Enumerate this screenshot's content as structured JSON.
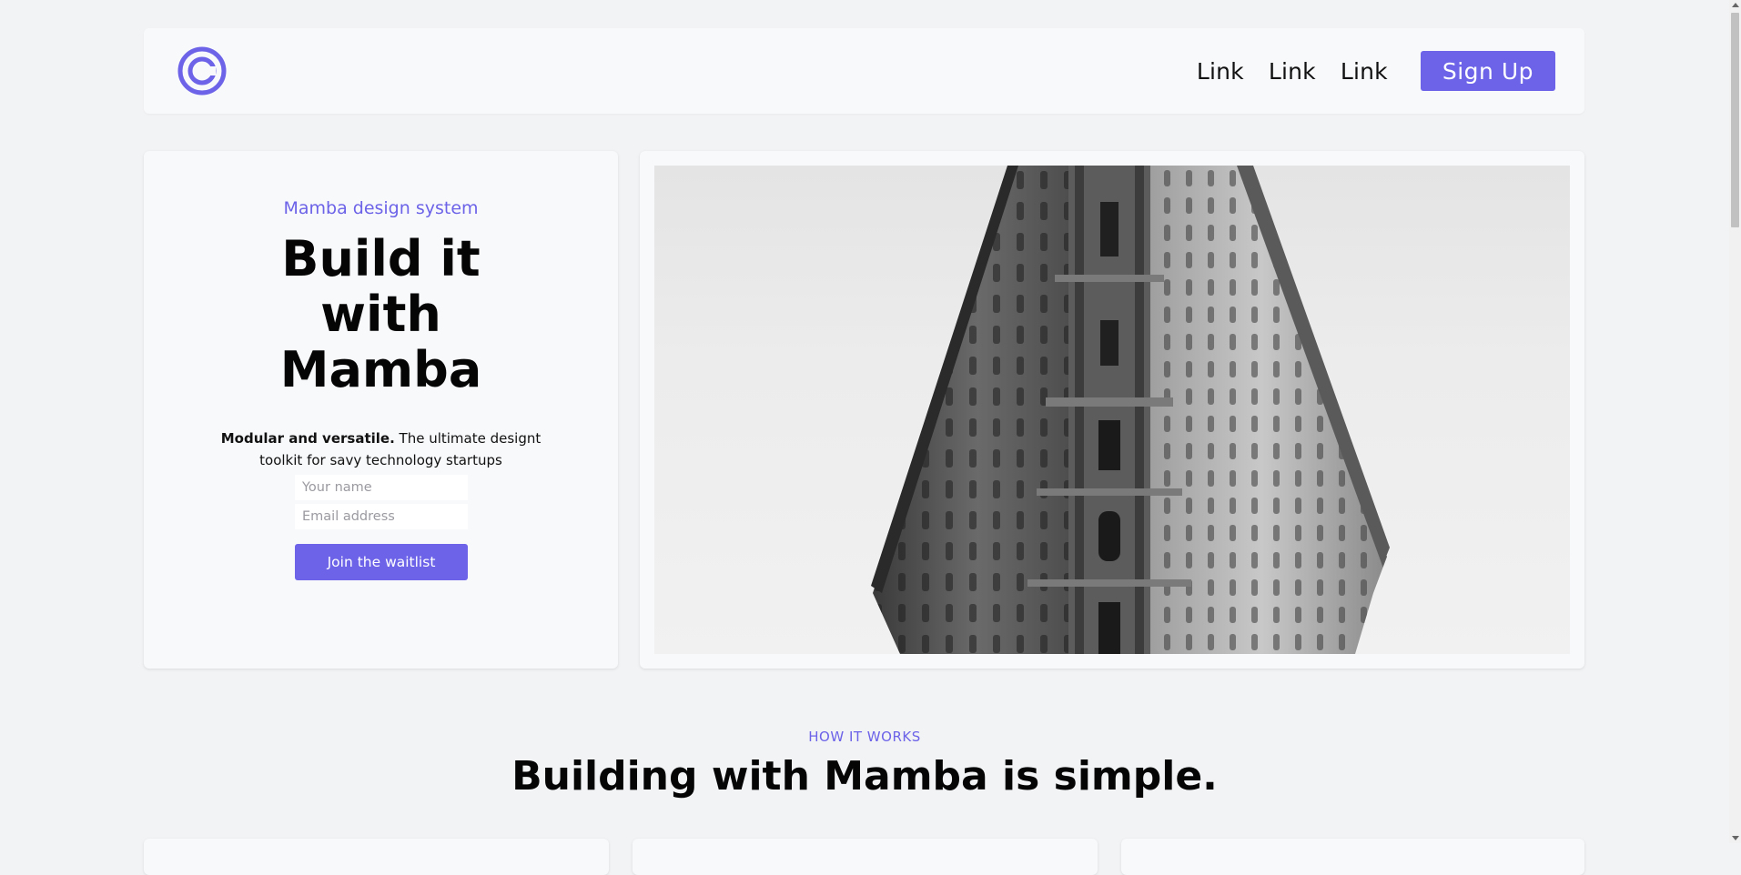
{
  "nav": {
    "logo_icon": "copyright-c-icon",
    "links": [
      "Link",
      "Link",
      "Link"
    ],
    "signup_label": "Sign Up"
  },
  "hero": {
    "eyebrow": "Mamba design system",
    "title_lines": [
      "Build it",
      "with",
      "Mamba"
    ],
    "desc_bold": "Modular and versatile.",
    "desc_rest": " The ultimate designt toolkit for savy technology startups",
    "name_placeholder": "Your name",
    "email_placeholder": "Email address",
    "join_label": "Join the waitlist"
  },
  "image": {
    "subject": "flatiron-building-photo"
  },
  "how": {
    "label": "HOW IT WORKS",
    "title": "Building with Mamba is simple."
  },
  "colors": {
    "accent": "#6c63e8",
    "background": "#f2f3f5",
    "card": "#f8f9fb"
  }
}
